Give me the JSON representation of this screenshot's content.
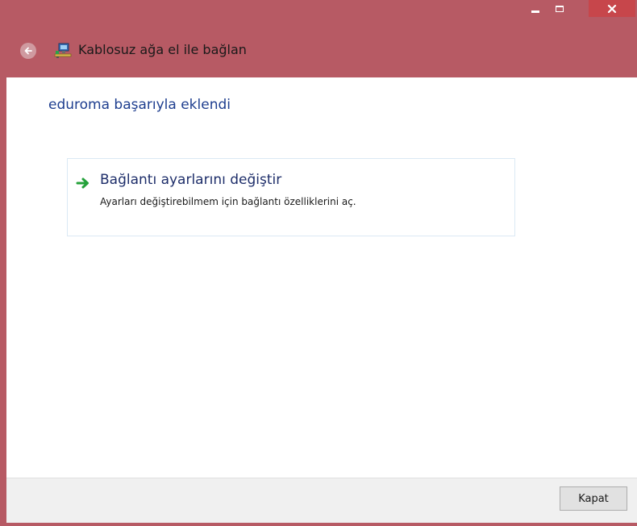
{
  "window": {
    "title": "Kablosuz ağa el ile bağlan",
    "frame_color": "#b75a64",
    "close_button_color": "#c7464b"
  },
  "main": {
    "heading": "eduroma başarıyla eklendi",
    "option": {
      "title": "Bağlantı ayarlarını değiştir",
      "description": "Ayarları değiştirebilmem için bağlantı özelliklerini aç.",
      "icon": "green-arrow-right-icon"
    }
  },
  "footer": {
    "close_label": "Kapat"
  },
  "icons": {
    "back": "back-arrow-icon",
    "network": "network-computer-icon",
    "minimize": "minimize-icon",
    "maximize": "maximize-icon",
    "close": "close-icon"
  }
}
